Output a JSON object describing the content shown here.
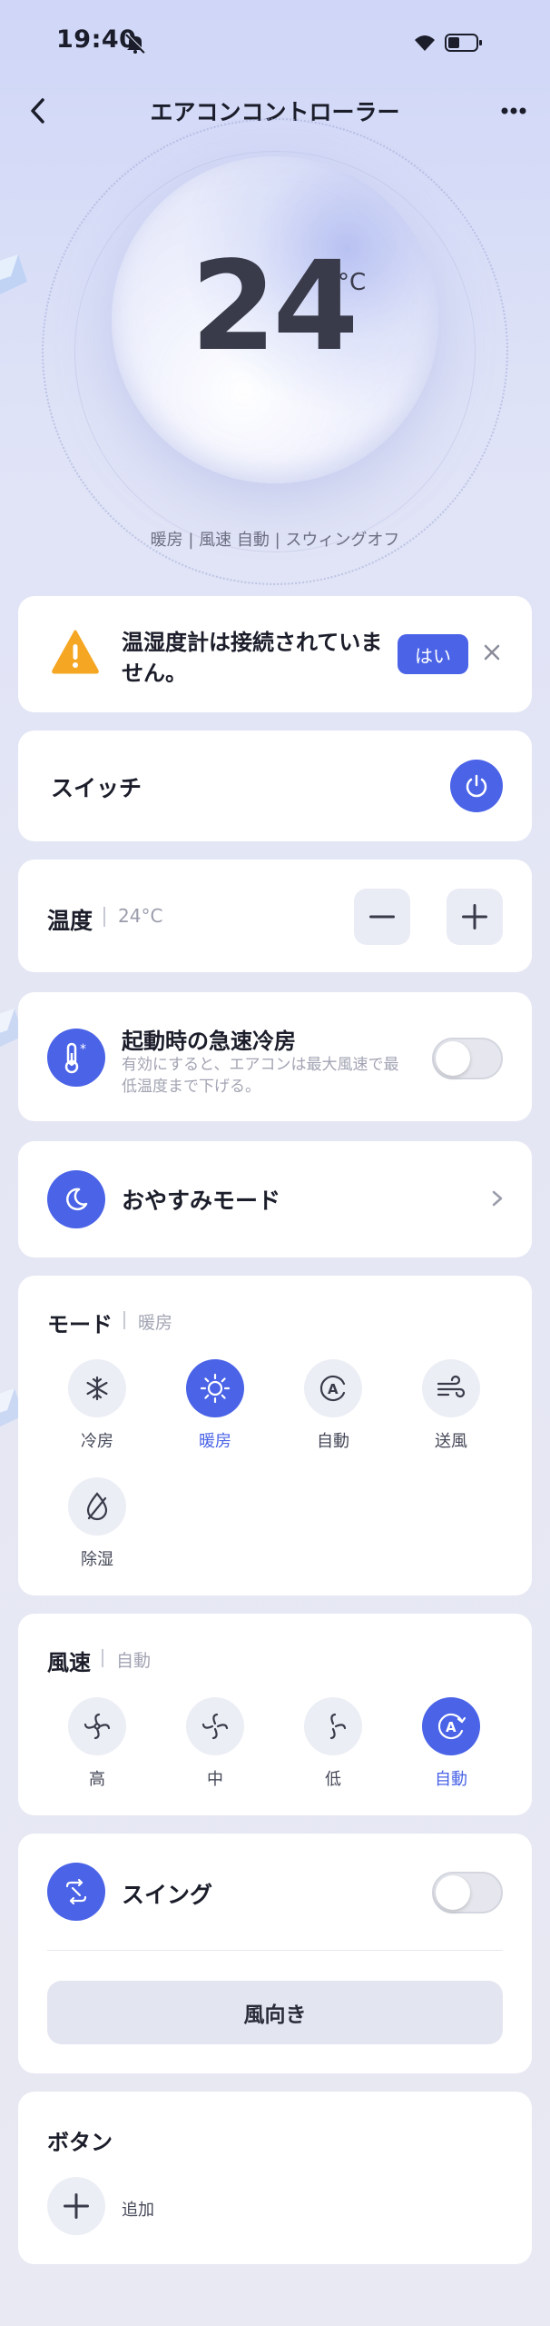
{
  "status_bar": {
    "time": "19:40"
  },
  "header": {
    "title": "エアコンコントローラー"
  },
  "dial": {
    "temperature": "24",
    "unit": "°C",
    "status": "暖房 | 風速 自動 | スウィングオフ"
  },
  "alert": {
    "message": "温湿度計は接続されていません。",
    "yes_label": "はい"
  },
  "switch": {
    "label": "スイッチ",
    "on": true
  },
  "temperature": {
    "label": "温度",
    "value": "24°C"
  },
  "quick_cool": {
    "title": "起動時の急速冷房",
    "description": "有効にすると、エアコンは最大風速で最低温度まで下げる。",
    "enabled": false
  },
  "sleep_mode": {
    "label": "おやすみモード"
  },
  "mode": {
    "title": "モード",
    "current": "暖房",
    "options": [
      {
        "label": "冷房",
        "icon": "snowflake-icon",
        "active": false
      },
      {
        "label": "暖房",
        "icon": "sun-icon",
        "active": true
      },
      {
        "label": "自動",
        "icon": "auto-icon",
        "active": false
      },
      {
        "label": "送風",
        "icon": "wind-icon",
        "active": false
      },
      {
        "label": "除湿",
        "icon": "drop-icon",
        "active": false
      }
    ]
  },
  "fan_speed": {
    "title": "風速",
    "current": "自動",
    "options": [
      {
        "label": "高",
        "icon": "fan-high-icon",
        "active": false
      },
      {
        "label": "中",
        "icon": "fan-mid-icon",
        "active": false
      },
      {
        "label": "低",
        "icon": "fan-low-icon",
        "active": false
      },
      {
        "label": "自動",
        "icon": "fan-auto-icon",
        "active": true
      }
    ]
  },
  "swing": {
    "label": "スイング",
    "enabled": false,
    "direction_label": "風向き"
  },
  "buttons": {
    "title": "ボタン",
    "add_label": "追加"
  },
  "colors": {
    "accent": "#4a63e7",
    "warning": "#f5a623"
  }
}
